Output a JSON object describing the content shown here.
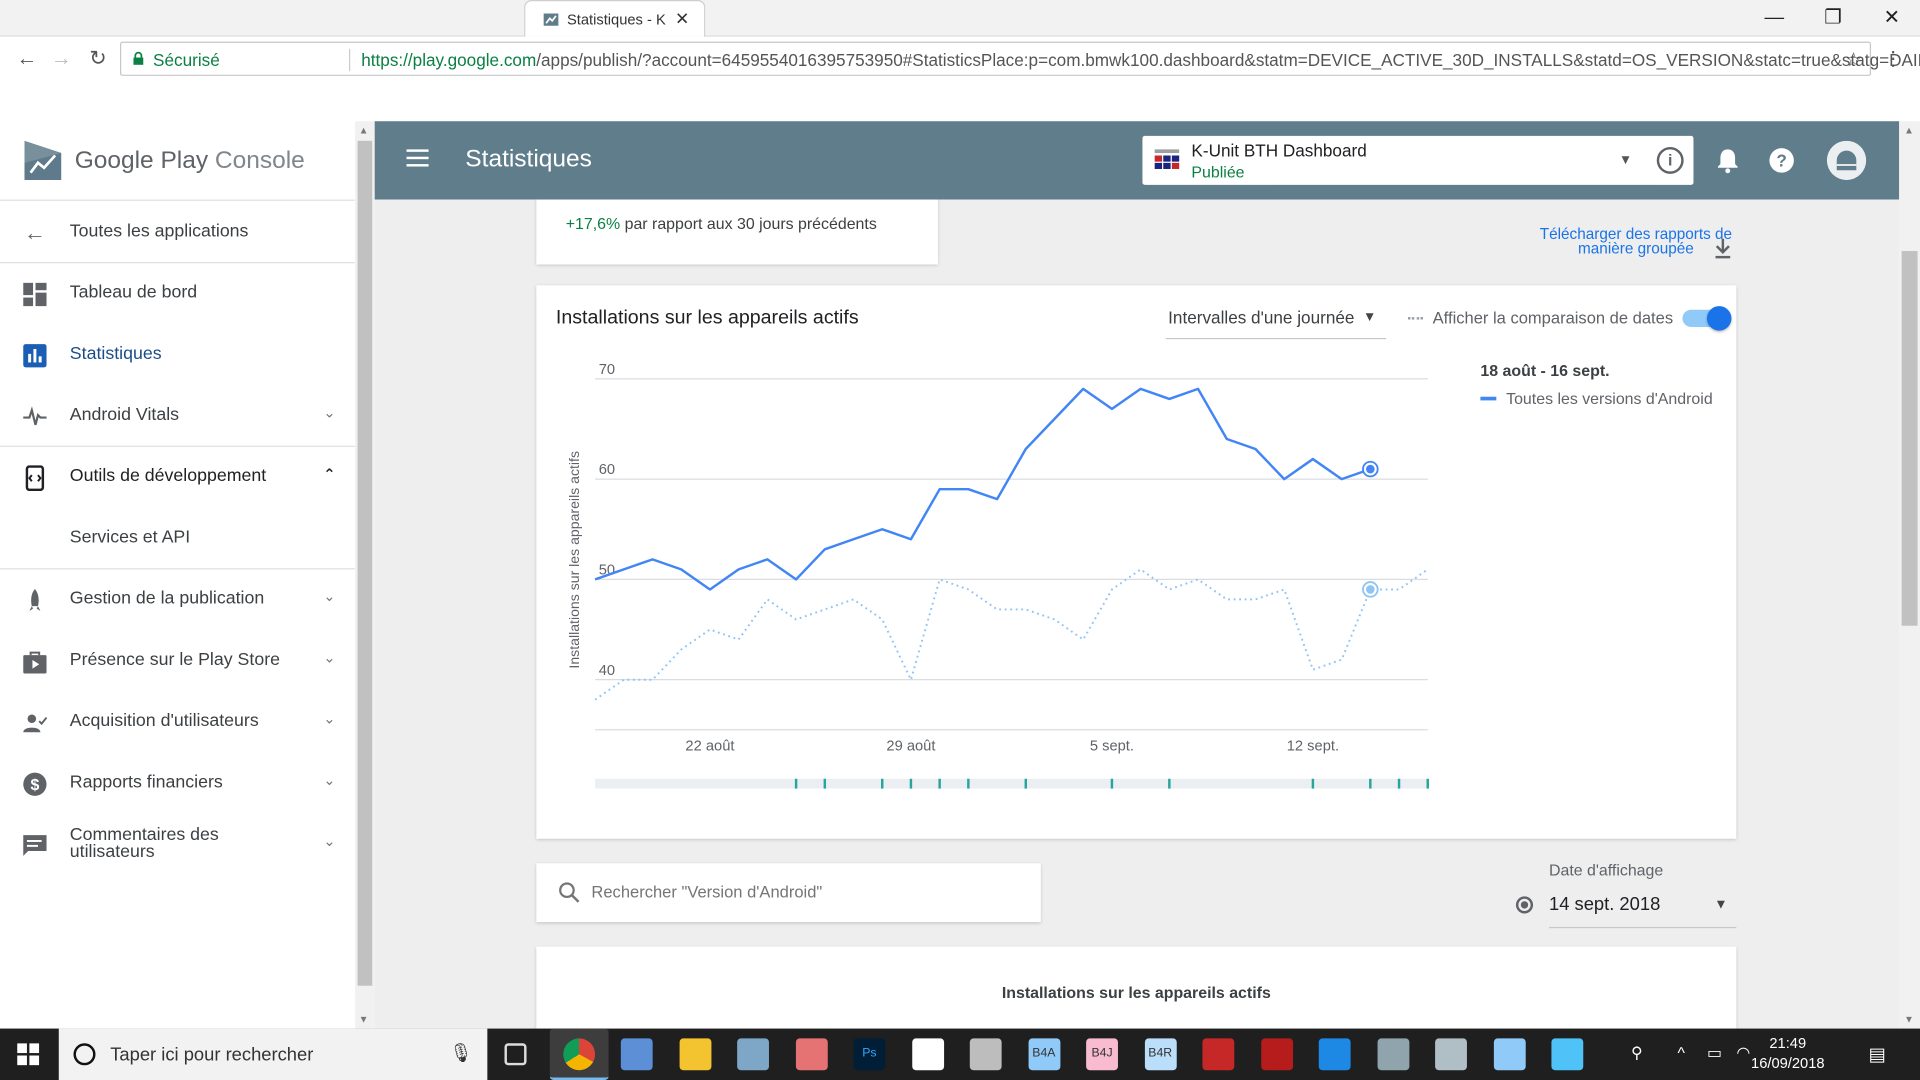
{
  "browser": {
    "tab_title": "Statistiques - K",
    "secure_label": "Sécurisé",
    "url_host": "https://play.google.com",
    "url_path": "/apps/publish/?account=6459554016395753950#StatisticsPlace:p=com.bmwk100.dashboard&statm=DEVICE_ACTIVE_30D_INSTALLS&statd=OS_VERSION&statc=true&statg=DAILY..."
  },
  "sidebar": {
    "brand_google_play": "Google Play",
    "brand_console": "Console",
    "items": [
      {
        "label": "Toutes les applications",
        "icon": "arrow-back-icon"
      },
      {
        "label": "Tableau de bord",
        "icon": "dashboard-icon"
      },
      {
        "label": "Statistiques",
        "icon": "bar-chart-icon"
      },
      {
        "label": "Android Vitals",
        "icon": "vitals-icon"
      },
      {
        "label": "Outils de développement",
        "icon": "dev-tools-icon"
      },
      {
        "label": "Services et API",
        "icon": ""
      },
      {
        "label": "Gestion de la publication",
        "icon": "rocket-icon"
      },
      {
        "label": "Présence sur le Play Store",
        "icon": "store-icon"
      },
      {
        "label": "Acquisition d'utilisateurs",
        "icon": "users-icon"
      },
      {
        "label": "Rapports financiers",
        "icon": "dollar-icon"
      },
      {
        "label": "Commentaires des utilisateurs",
        "icon": "comments-icon"
      }
    ]
  },
  "header": {
    "title": "Statistiques",
    "app_name": "K-Unit BTH Dashboard",
    "app_status": "Publiée",
    "status_color": "#0b8043",
    "header_color": "#607d8b"
  },
  "kpi": {
    "change_pct": "+17,6%",
    "change_text": "par rapport aux 30 jours précédents"
  },
  "download": {
    "line1": "Télécharger des rapports de",
    "line2": "manière groupée"
  },
  "chart_card": {
    "title": "Installations sur les appareils actifs",
    "interval": "Intervalles d'une journée",
    "compare_label": "Afficher la comparaison de dates",
    "compare_on": true,
    "legend_date": "18 août - 16 sept.",
    "legend_series": "Toutes les versions d'Android"
  },
  "chart_data": {
    "type": "line",
    "ylabel": "Installations sur les appareils actifs",
    "xlabel": "",
    "ylim": [
      35,
      72
    ],
    "yticks": [
      "40",
      "50",
      "60",
      "70"
    ],
    "yticks_values": [
      40,
      50,
      60,
      70
    ],
    "xticks": [
      "22 août",
      "29 août",
      "5 sept.",
      "12 sept."
    ],
    "xticks_values": [
      4,
      11,
      18,
      25
    ],
    "x_start": "2018-08-18",
    "series": [
      {
        "name": "Toutes les versions d'Android",
        "style": "solid",
        "color": "#4285f4",
        "x": [
          0,
          1,
          2,
          3,
          4,
          5,
          6,
          7,
          8,
          9,
          10,
          11,
          12,
          13,
          14,
          15,
          16,
          17,
          18,
          19,
          20,
          21,
          22,
          23,
          24,
          25,
          26,
          27
        ],
        "values": [
          50,
          51,
          52,
          51,
          49,
          51,
          52,
          50,
          53,
          54,
          55,
          54,
          59,
          59,
          58,
          63,
          66,
          69,
          67,
          69,
          68,
          69,
          64,
          63,
          60,
          62,
          60,
          61
        ]
      },
      {
        "name": "",
        "style": "dotted",
        "color": "#90c4f4",
        "x": [
          0,
          1,
          2,
          3,
          4,
          5,
          6,
          7,
          8,
          9,
          10,
          11,
          12,
          13,
          14,
          15,
          16,
          17,
          18,
          19,
          20,
          21,
          22,
          23,
          24,
          25,
          26,
          27,
          28,
          29
        ],
        "values": [
          38,
          40,
          40,
          43,
          45,
          44,
          48,
          46,
          47,
          48,
          46,
          40,
          50,
          49,
          47,
          47,
          46,
          44,
          49,
          51,
          49,
          50,
          48,
          48,
          49,
          41,
          42,
          49,
          49,
          51
        ]
      }
    ],
    "grid": true,
    "legend": "right"
  },
  "search": {
    "placeholder": "Rechercher \"Version d'Android\""
  },
  "date_display": {
    "label": "Date d'affichage",
    "value": "14 sept. 2018"
  },
  "table_card": {
    "title": "Installations sur les appareils actifs"
  },
  "taskbar": {
    "search_placeholder": "Taper ici pour rechercher",
    "time": "21:49",
    "date": "16/09/2018",
    "apps": [
      "task-view-icon",
      "chrome-icon",
      "app-icon",
      "file-explorer-icon",
      "app-icon",
      "app-icon",
      "photoshop-icon",
      "store-icon",
      "app-icon",
      "b4a-icon",
      "b4j-icon",
      "b4r-icon",
      "pdf-icon",
      "filezilla-icon",
      "edge-icon",
      "app-icon",
      "virtualbox-icon",
      "network-icon",
      "app-icon"
    ],
    "app_labels": {
      "ps": "Ps",
      "b4a": "B4A",
      "b4j": "B4J",
      "b4r": "B4R"
    }
  }
}
